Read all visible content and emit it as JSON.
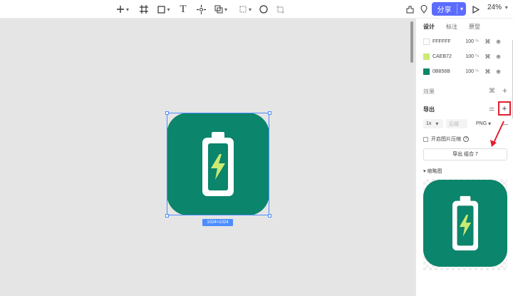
{
  "toolbar": {
    "tools": [
      "add-icon",
      "frame-icon",
      "rectangle-icon",
      "text-icon",
      "move-icon",
      "boolean-icon",
      "component-icon",
      "ellipse-icon",
      "crop-icon"
    ],
    "share_label": "分享",
    "zoom": "24%"
  },
  "canvas": {
    "dimension_badge": "1024×1024"
  },
  "panel": {
    "tabs": [
      "设计",
      "标注",
      "原型"
    ],
    "colors": [
      {
        "hex": "FFFFFF",
        "opacity": "100",
        "swatch": "#ffffff"
      },
      {
        "hex": "CAEB72",
        "opacity": "100",
        "swatch": "#caeb72"
      },
      {
        "hex": "0B856B",
        "opacity": "100",
        "swatch": "#0b856b"
      }
    ],
    "percent_sign": "%",
    "effects_label": "效果",
    "export_label": "导出",
    "export_scale": "1x",
    "export_suffix_placeholder": "后缀",
    "export_format": "PNG",
    "compress_label": "开启图片压缩",
    "export_button": "导出 组合 7",
    "thumbnail_label": "缩略图"
  },
  "accent": "#5b6cff",
  "icon_color": "#0b856b",
  "bolt_color": "#caeb72",
  "annotation_color": "#e21f2f"
}
